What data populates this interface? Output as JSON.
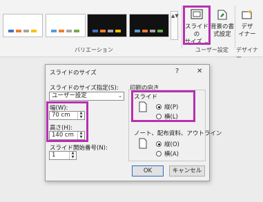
{
  "ribbon": {
    "variations_label": "バリエーション",
    "user_settings_label": "ユーザー設定",
    "designer_label": "デザイナー",
    "slide_size_label": "スライドの\nサイズ ⌄",
    "bg_format_label": "背景の書\n式設定",
    "designer_btn_label": "デザ\nイナー",
    "gallery_more": "▲▼",
    "theme_colors": [
      "#4472c4",
      "#ed7d31",
      "#a5a5a5",
      "#ffc000",
      "#5b9bd5",
      "#70ad47"
    ]
  },
  "dialog": {
    "title": "スライドのサイズ",
    "help": "?",
    "close": "✕",
    "size_for_label": "スライドのサイズ指定(S):",
    "size_for_value": "ユーザー設定",
    "width_label": "幅(W):",
    "width_value": "70 cm",
    "height_label": "高さ(H):",
    "height_value": "140 cm",
    "start_label": "スライド開始番号(N):",
    "start_value": "1",
    "orientation_label": "印刷の向き",
    "slides_label": "スライド",
    "portrait_label": "縦(P)",
    "landscape_label": "横(L)",
    "notes_label": "ノート、配布資料、アウトライン",
    "notes_portrait_label": "縦(O)",
    "notes_landscape_label": "横(A)",
    "ok_label": "OK",
    "cancel_label": "キャンセル"
  }
}
